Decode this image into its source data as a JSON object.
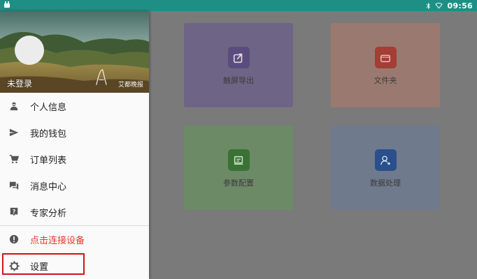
{
  "status_bar": {
    "time": "09:56",
    "icons": [
      "android-debug-icon",
      "bluetooth-icon",
      "wifi-icon"
    ]
  },
  "drawer": {
    "header": {
      "login_status": "未登录",
      "brand_text": "艾都晚报"
    },
    "menu_items": [
      {
        "label": "个人信息",
        "icon": "person-icon"
      },
      {
        "label": "我的钱包",
        "icon": "send-icon"
      },
      {
        "label": "订单列表",
        "icon": "cart-icon"
      },
      {
        "label": "消息中心",
        "icon": "chat-icon"
      },
      {
        "label": "专家分析",
        "icon": "help-icon"
      }
    ],
    "connect_item": {
      "label": "点击连接设备",
      "icon": "alert-icon",
      "color": "#e53a2a"
    },
    "settings_item": {
      "label": "设置",
      "icon": "gear-icon"
    }
  },
  "main": {
    "tiles": [
      {
        "label": "触屏导出",
        "icon": "export-icon",
        "color": "#6e6485"
      },
      {
        "label": "文件夹",
        "icon": "folder-icon",
        "color": "#9a7970"
      },
      {
        "label": "参数配置",
        "icon": "config-icon",
        "color": "#6c8a66"
      },
      {
        "label": "数据处理",
        "icon": "user-data-icon",
        "color": "#6f7a8c"
      }
    ]
  },
  "colors": {
    "status_bar": "#1f8f86",
    "highlight_border": "#d4121a"
  }
}
